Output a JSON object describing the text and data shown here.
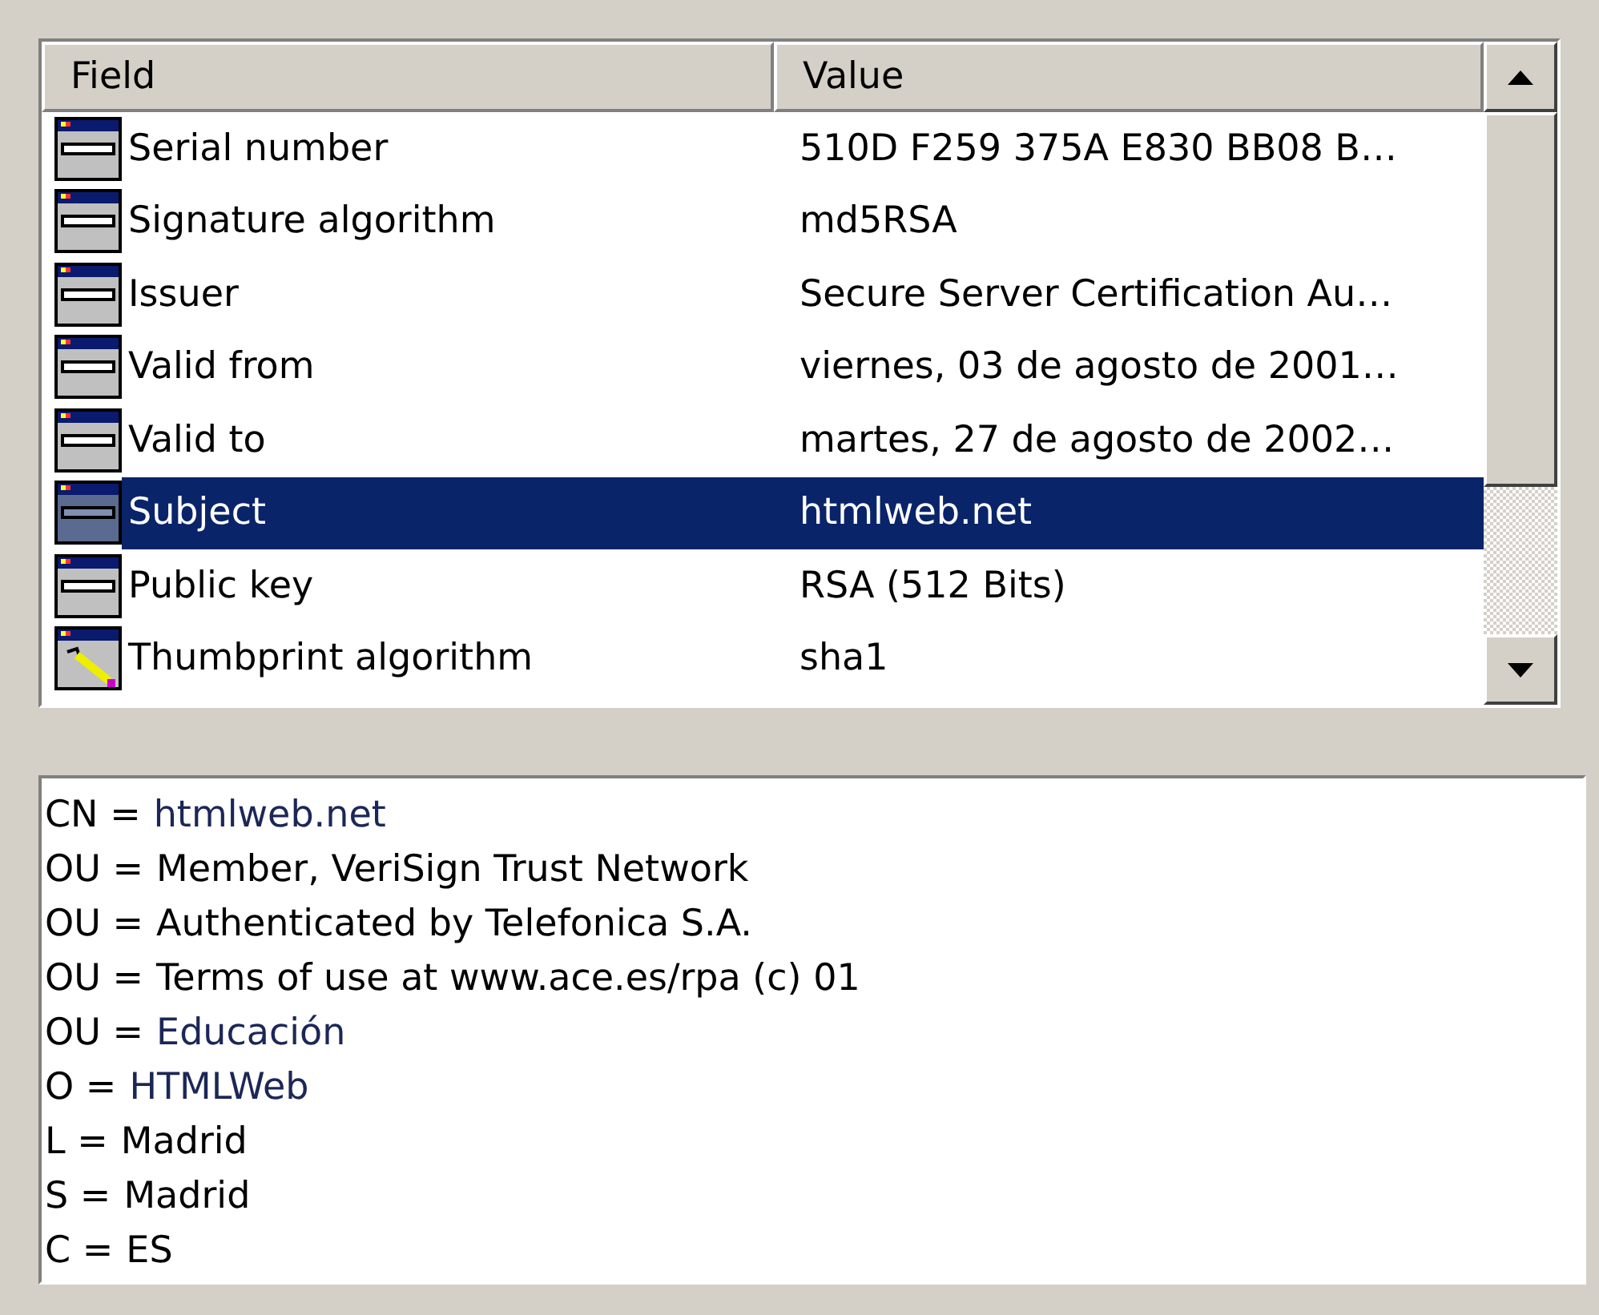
{
  "list": {
    "columns": [
      "Field",
      "Value"
    ],
    "rows": [
      {
        "kind": "field",
        "field": "Serial number",
        "value": "510D F259 375A E830 BB08 B…",
        "selected": false
      },
      {
        "kind": "field",
        "field": "Signature algorithm",
        "value": "md5RSA",
        "selected": false
      },
      {
        "kind": "field",
        "field": "Issuer",
        "value": "Secure Server Certification Au…",
        "selected": false
      },
      {
        "kind": "field",
        "field": "Valid from",
        "value": "viernes, 03 de agosto de 2001…",
        "selected": false
      },
      {
        "kind": "field",
        "field": "Valid to",
        "value": "martes, 27 de agosto de 2002…",
        "selected": false
      },
      {
        "kind": "field",
        "field": "Subject",
        "value": "htmlweb.net",
        "selected": true
      },
      {
        "kind": "field",
        "field": "Public key",
        "value": "RSA (512 Bits)",
        "selected": false
      },
      {
        "kind": "thumbprint",
        "field": "Thumbprint algorithm",
        "value": "sha1",
        "selected": false
      }
    ]
  },
  "details": [
    {
      "label": "CN =",
      "value": "htmlweb.net",
      "color": "#1c2757"
    },
    {
      "label": "OU =",
      "value": "Member, VeriSign Trust Network",
      "color": "#000000"
    },
    {
      "label": "OU =",
      "value": "Authenticated by Telefonica S.A.",
      "color": "#000000"
    },
    {
      "label": "OU =",
      "value": "Terms of use at www.ace.es/rpa (c) 01",
      "color": "#000000"
    },
    {
      "label": "OU =",
      "value": "Educación",
      "color": "#1c2757"
    },
    {
      "label": "O =",
      "value": "HTMLWeb",
      "color": "#1c2757"
    },
    {
      "label": "L =",
      "value": "Madrid",
      "color": "#000000"
    },
    {
      "label": "S =",
      "value": "Madrid",
      "color": "#000000"
    },
    {
      "label": "C =",
      "value": "ES",
      "color": "#000000"
    }
  ]
}
